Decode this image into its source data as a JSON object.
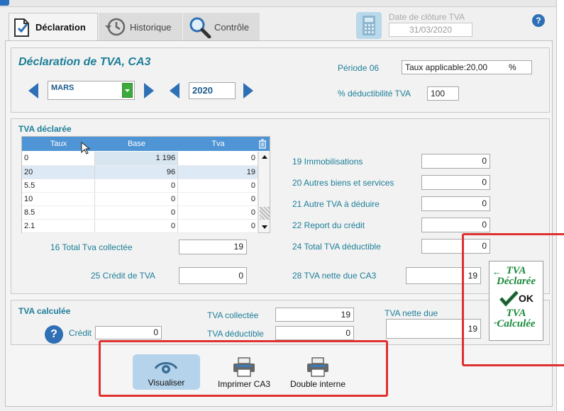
{
  "tabs": [
    {
      "label": "Déclaration"
    },
    {
      "label": "Historique"
    },
    {
      "label": "Contrôle"
    }
  ],
  "closing": {
    "label": "Date de clôture TVA",
    "value": "31/03/2020"
  },
  "help_glyph": "?",
  "header": {
    "title": "Déclaration de TVA, CA3",
    "month": "MARS",
    "year": "2020",
    "period_label": "Période 06",
    "rate_label": "Taux applicable:",
    "rate_value": "20,00",
    "rate_unit": "%",
    "deductibility_label": "% déductibilité TVA",
    "deductibility_value": "100"
  },
  "declared": {
    "title": "TVA déclarée",
    "columns": [
      "Taux",
      "Base",
      "Tva"
    ],
    "rows": [
      {
        "taux": "0",
        "base": "1 196",
        "tva": "0"
      },
      {
        "taux": "20",
        "base": "96",
        "tva": "19"
      },
      {
        "taux": "5.5",
        "base": "0",
        "tva": "0"
      },
      {
        "taux": "10",
        "base": "0",
        "tva": "0"
      },
      {
        "taux": "8.5",
        "base": "0",
        "tva": "0"
      },
      {
        "taux": "2.1",
        "base": "0",
        "tva": "0"
      }
    ],
    "total_collected_label": "16 Total Tva collectée",
    "total_collected_value": "19",
    "credit_label": "25 Crédit de TVA",
    "credit_value": "0",
    "lines": [
      {
        "label": "19  Immobilisations",
        "value": "0"
      },
      {
        "label": "20 Autres biens et services",
        "value": "0"
      },
      {
        "label": "21 Autre TVA à déduire",
        "value": "0"
      },
      {
        "label": "22 Report du crédit",
        "value": "0"
      },
      {
        "label": "24 Total TVA déductible",
        "value": "0"
      },
      {
        "label": "28 TVA nette due CA3",
        "value": "19"
      }
    ]
  },
  "transfer": {
    "top": "TVA Déclarée",
    "ok": "OK",
    "bottom": "TVA Calculée"
  },
  "calculated": {
    "title": "TVA calculée",
    "credit_label": "Crédit",
    "credit_value": "0",
    "collected_label": "TVA collectée",
    "collected_value": "19",
    "deductible_label": "TVA déductible",
    "deductible_value": "0",
    "net_label": "TVA nette due",
    "net_value": "19"
  },
  "actions": [
    {
      "label": "Visualiser"
    },
    {
      "label": "Imprimer CA3"
    },
    {
      "label": "Double interne"
    }
  ],
  "colors": {
    "accent": "#1d7e98",
    "arrows": "#2f6fb5",
    "highlight_box": "#e03030"
  }
}
